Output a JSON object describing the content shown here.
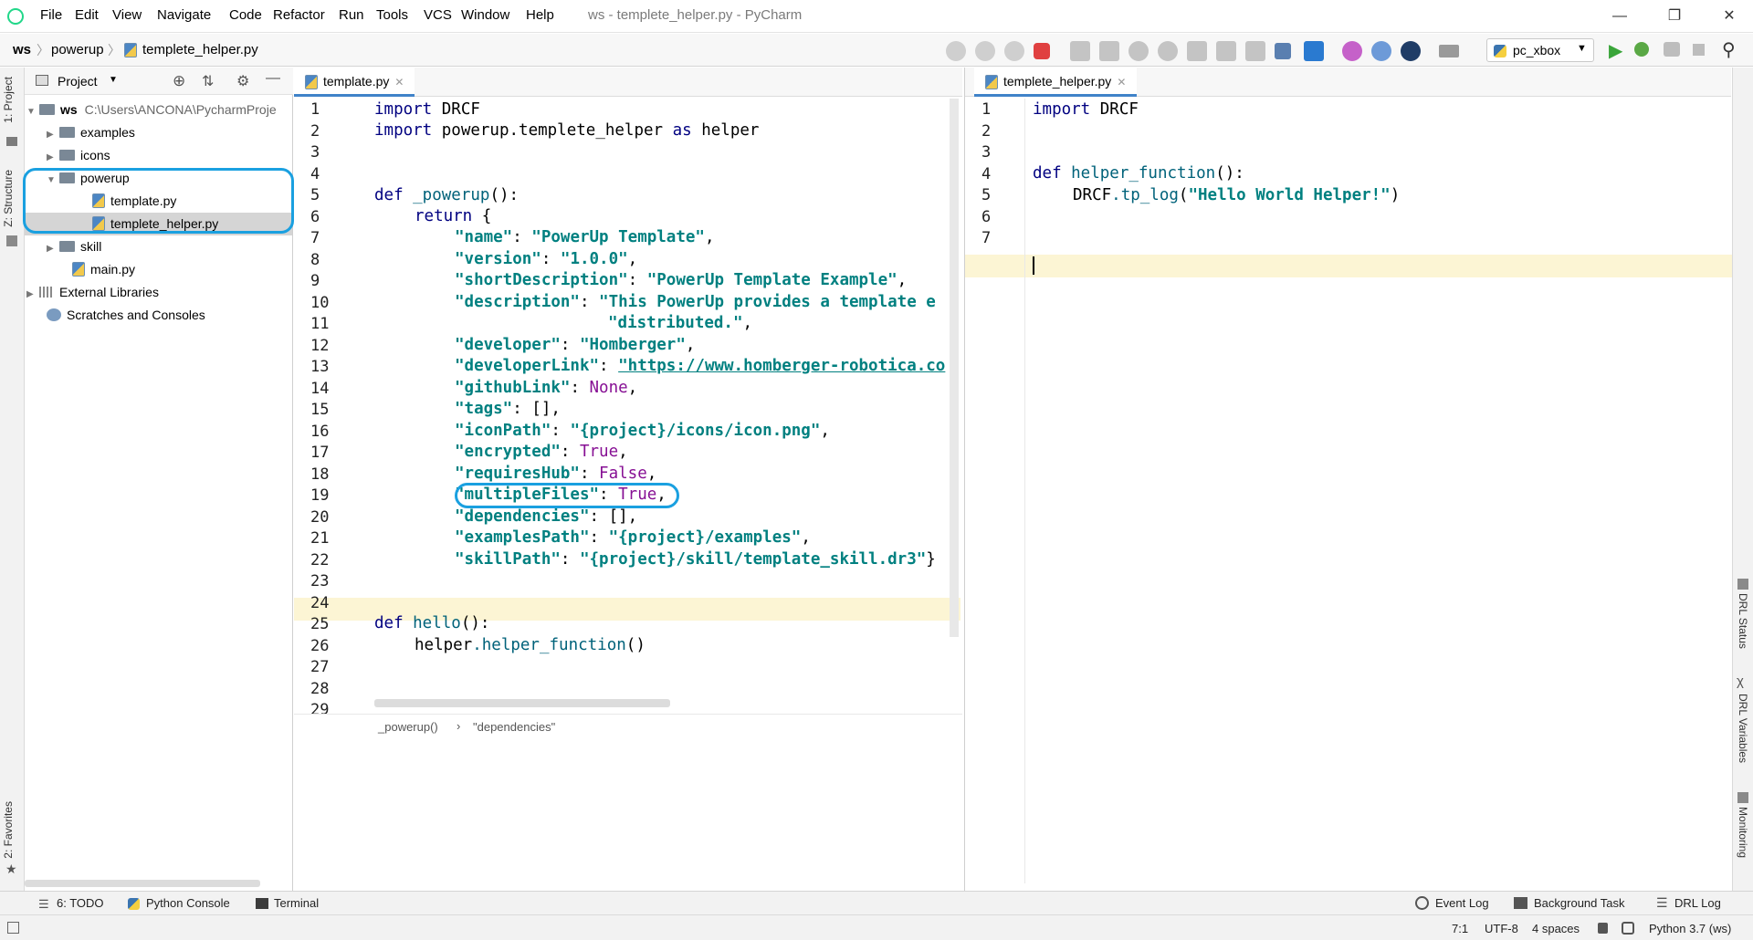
{
  "window": {
    "title": "ws - templete_helper.py - PyCharm",
    "menu": [
      "File",
      "Edit",
      "View",
      "Navigate",
      "Code",
      "Refactor",
      "Run",
      "Tools",
      "VCS",
      "Window",
      "Help"
    ]
  },
  "breadcrumbs": [
    "ws",
    "powerup",
    "templete_helper.py"
  ],
  "run_config": "pc_xbox",
  "left_tool_tabs": [
    "1: Project",
    "Z: Structure",
    "2: Favorites"
  ],
  "right_tool_tabs": [
    "DRL Status",
    "DRL Variables",
    "Monitoring"
  ],
  "project": {
    "header": "Project",
    "root": {
      "name": "ws",
      "path": "C:\\Users\\ANCONA\\PycharmProje"
    },
    "items": {
      "examples": "examples",
      "icons": "icons",
      "powerup": "powerup",
      "template": "template.py",
      "helper": "templete_helper.py",
      "skill": "skill",
      "main": "main.py",
      "libs": "External Libraries",
      "scratches": "Scratches and Consoles"
    }
  },
  "editor_left": {
    "tab": "template.py",
    "line_numbers": [
      "1",
      "2",
      "3",
      "4",
      "5",
      "6",
      "7",
      "8",
      "9",
      "10",
      "11",
      "12",
      "13",
      "14",
      "15",
      "16",
      "17",
      "18",
      "19",
      "20",
      "21",
      "22",
      "23",
      "24",
      "25",
      "26",
      "27",
      "28",
      "29"
    ],
    "breadcrumb": [
      "_powerup()",
      "\"dependencies\""
    ],
    "code": {
      "l1a": "import",
      "l1b": " DRCF",
      "l2a": "import",
      "l2b": " powerup.templete_helper ",
      "l2c": "as",
      "l2d": " helper",
      "l5a": "def",
      "l5b": " _powerup",
      "l5c": "():",
      "l6a": "return",
      "l6b": " {",
      "k7": "\"name\"",
      "v7": "\"PowerUp Template\"",
      "k8": "\"version\"",
      "v8": "\"1.0.0\"",
      "k9": "\"shortDescription\"",
      "v9": "\"PowerUp Template Example\"",
      "k10": "\"description\"",
      "v10": "\"This PowerUp provides a template e",
      "v11": "\"distributed.\"",
      "k12": "\"developer\"",
      "v12": "\"Homberger\"",
      "k13": "\"developerLink\"",
      "v13": "\"https://www.homberger-robotica.co",
      "k14": "\"githubLink\"",
      "v14": "None",
      "k15": "\"tags\"",
      "v15": "[]",
      "k16": "\"iconPath\"",
      "v16": "\"{project}/icons/icon.png\"",
      "k17": "\"encrypted\"",
      "v17": "True",
      "k18": "\"requiresHub\"",
      "v18": "False",
      "k19": "\"multipleFiles\"",
      "v19": "True",
      "k20": "\"dependencies\"",
      "v20": "[]",
      "k21": "\"examplesPath\"",
      "v21": "\"{project}/examples\"",
      "k22": "\"skillPath\"",
      "v22": "\"{project}/skill/template_skill.dr3\"",
      "l25a": "def",
      "l25b": " hello",
      "l25c": "():",
      "l26a": "helper",
      "l26b": ".helper_function",
      "l26c": "()"
    }
  },
  "editor_right": {
    "tab": "templete_helper.py",
    "line_numbers": [
      "1",
      "2",
      "3",
      "4",
      "5",
      "6",
      "7"
    ],
    "code": {
      "l1a": "import",
      "l1b": " DRCF",
      "l4a": "def",
      "l4b": " helper_function",
      "l4c": "():",
      "l5a": "DRCF",
      "l5b": ".tp_log",
      "l5c": "(",
      "l5d": "\"Hello World Helper!\"",
      "l5e": ")"
    }
  },
  "bottom_tools": {
    "todo": "6: TODO",
    "python_console": "Python Console",
    "terminal": "Terminal",
    "event_log": "Event Log",
    "background_task": "Background Task",
    "drl_log": "DRL Log"
  },
  "status": {
    "position": "7:1",
    "encoding": "UTF-8",
    "indent": "4 spaces",
    "interpreter": "Python 3.7 (ws)"
  },
  "colors": {
    "annotation": "#1aa0e0",
    "current_line": "#fcf5d4",
    "selected_row": "#d5d5d5",
    "tab_underline": "#4083c9"
  }
}
